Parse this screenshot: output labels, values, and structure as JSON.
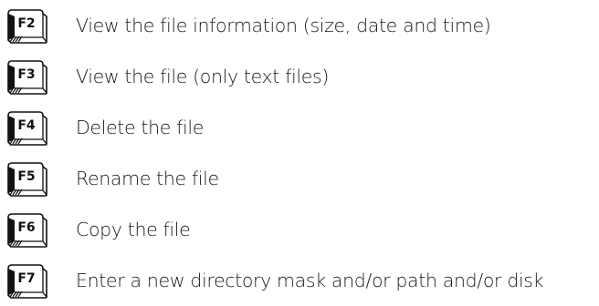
{
  "keys": [
    {
      "key": "F2",
      "description": "View the file information (size, date and time)"
    },
    {
      "key": "F3",
      "description": "View the file (only text files)"
    },
    {
      "key": "F4",
      "description": "Delete the file"
    },
    {
      "key": "F5",
      "description": "Rename the file"
    },
    {
      "key": "F6",
      "description": "Copy the file"
    },
    {
      "key": "F7",
      "description": "Enter a new directory mask and/or path and/or disk"
    }
  ]
}
